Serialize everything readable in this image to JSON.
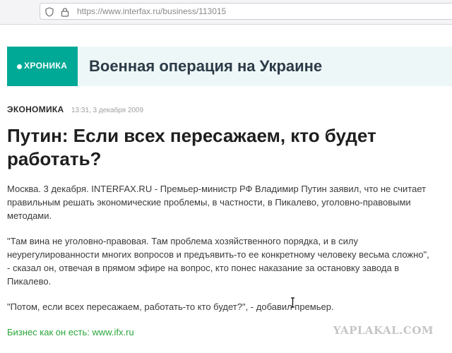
{
  "browser": {
    "url": "https://www.interfax.ru/business/113015",
    "icons": [
      "shield-icon",
      "lock-icon"
    ]
  },
  "banner": {
    "tag": "ХРОНИКА",
    "title": "Военная операция на Украине",
    "colors": {
      "tag_bg": "#00a896",
      "banner_bg": "#eef7f7"
    }
  },
  "article": {
    "category": "ЭКОНОМИКА",
    "date": "13:31, 3 декабря 2009",
    "headline": "Путин: Если всех пересажаем, кто будет работать?",
    "paragraphs": [
      "Москва. 3 декабря. INTERFAX.RU - Премьер-министр РФ Владимир Путин заявил, что не считает правильным решать экономические проблемы, в частности, в Пикалево, уголовно-правовыми методами.",
      "\"Там вина не уголовно-правовая. Там проблема хозяйственного порядка, и в силу неурегулированности многих вопросов и предъявить-то ее конкретному человеку весьма сложно\", - сказал он, отвечая в прямом эфире на вопрос, кто понес наказание за остановку завода в Пикалево.",
      "\"Потом, если всех пересажаем, работать-то кто будет?\", - добавил премьер."
    ],
    "footer_link": "Бизнес как он есть: www.ifx.ru"
  },
  "watermark": "YAPLAKAL.COM"
}
